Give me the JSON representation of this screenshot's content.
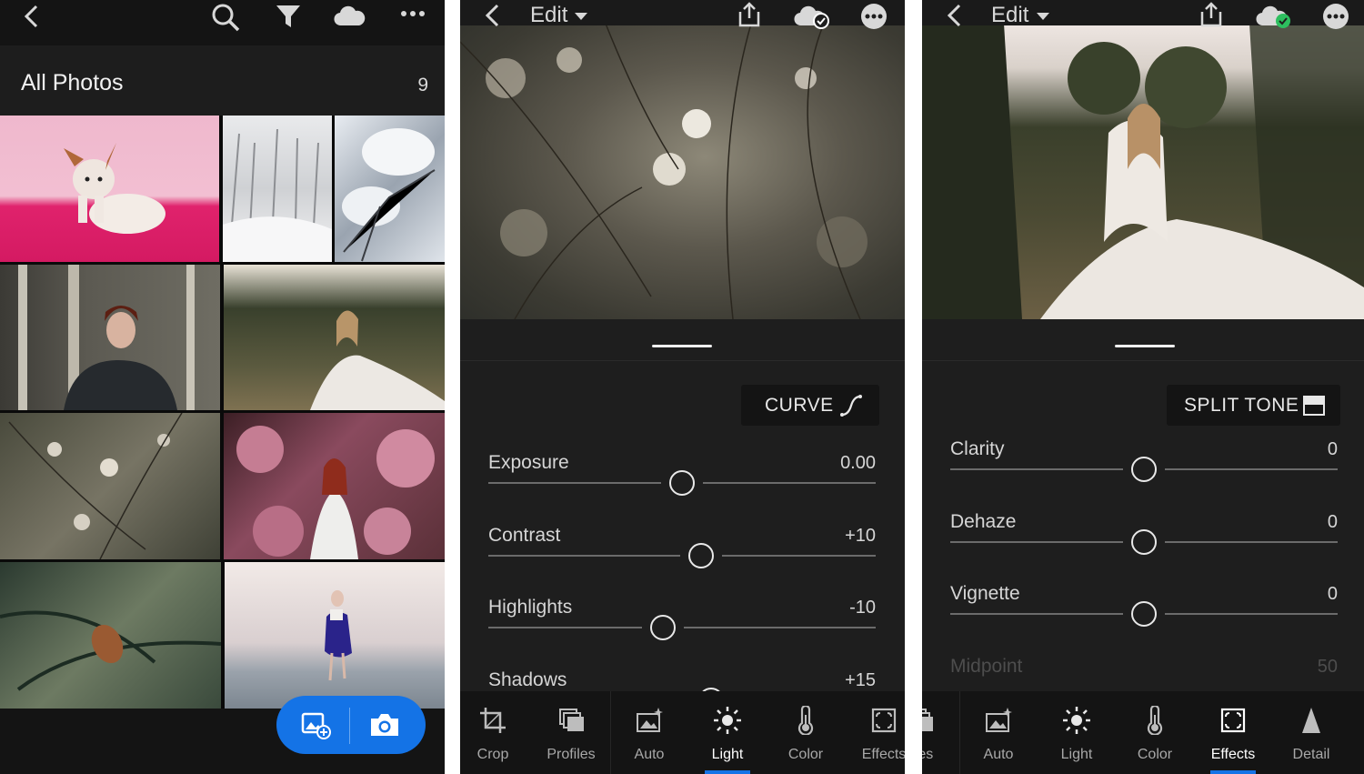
{
  "screen1": {
    "title": "All Photos",
    "count": "9",
    "icons": [
      "back-chevron-icon",
      "search-icon",
      "filter-icon",
      "cloud-icon",
      "more-icon",
      "add-photo-icon",
      "camera-icon"
    ]
  },
  "screen2": {
    "edit_label": "Edit",
    "mode_label": "CURVE",
    "sliders": [
      {
        "label": "Exposure",
        "value": "0.00",
        "fraction": 0.5
      },
      {
        "label": "Contrast",
        "value": "+10",
        "fraction": 0.55
      },
      {
        "label": "Highlights",
        "value": "-10",
        "fraction": 0.45
      },
      {
        "label": "Shadows",
        "value": "+15",
        "fraction": 0.575
      }
    ],
    "tools": [
      {
        "label": "Crop",
        "icon": "crop-icon"
      },
      {
        "label": "Profiles",
        "icon": "profiles-icon"
      },
      {
        "label": "Auto",
        "icon": "auto-icon"
      },
      {
        "label": "Light",
        "icon": "light-icon",
        "active": true
      },
      {
        "label": "Color",
        "icon": "color-icon"
      },
      {
        "label": "Effects",
        "icon": "effects-icon"
      }
    ]
  },
  "screen3": {
    "edit_label": "Edit",
    "mode_label": "SPLIT TONE",
    "sliders": [
      {
        "label": "Clarity",
        "value": "0",
        "fraction": 0.5
      },
      {
        "label": "Dehaze",
        "value": "0",
        "fraction": 0.5
      },
      {
        "label": "Vignette",
        "value": "0",
        "fraction": 0.5
      },
      {
        "label": "Midpoint",
        "value": "50",
        "fraction": 0.5,
        "disabled": true
      }
    ],
    "tools": [
      {
        "label": "files",
        "icon": "profiles-icon"
      },
      {
        "label": "Auto",
        "icon": "auto-icon"
      },
      {
        "label": "Light",
        "icon": "light-icon"
      },
      {
        "label": "Color",
        "icon": "color-icon"
      },
      {
        "label": "Effects",
        "icon": "effects-icon",
        "active": true
      },
      {
        "label": "Detail",
        "icon": "detail-icon"
      }
    ]
  },
  "colors": {
    "accent": "#1473e6",
    "sync_check": "#2dbf5f"
  }
}
